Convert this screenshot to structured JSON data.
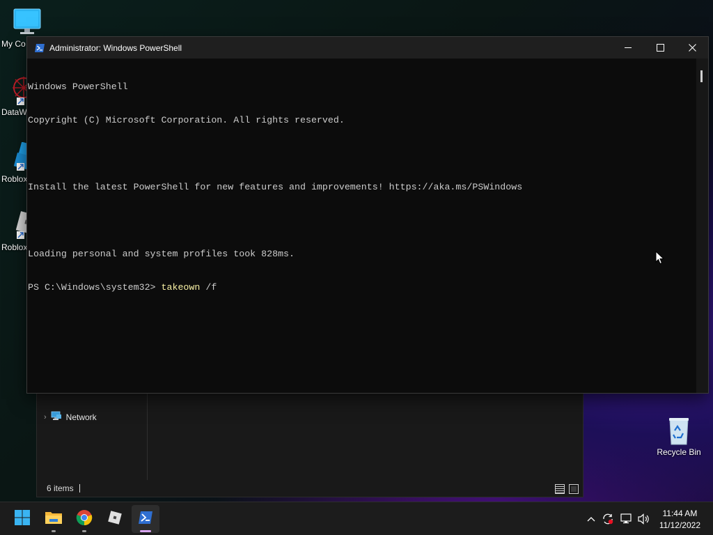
{
  "desktop": {
    "icons": [
      {
        "label": "My Co",
        "icon": "computer-icon"
      },
      {
        "label": "DataW",
        "icon": "datawrapper-icon"
      },
      {
        "label": "Roblox",
        "icon": "roblox-studio-icon"
      },
      {
        "label": "Roblox",
        "icon": "roblox-player-icon"
      },
      {
        "label": "Recycle Bin",
        "icon": "recycle-bin-icon"
      }
    ]
  },
  "explorer": {
    "nav_item": "Network",
    "status_count": "6 items"
  },
  "powershell": {
    "title": "Administrator: Windows PowerShell",
    "lines": [
      "Windows PowerShell",
      "Copyright (C) Microsoft Corporation. All rights reserved.",
      "",
      "Install the latest PowerShell for new features and improvements! https://aka.ms/PSWindows",
      "",
      "Loading personal and system profiles took 828ms."
    ],
    "prompt": "PS C:\\Windows\\system32> ",
    "command": "takeown",
    "argument": " /f"
  },
  "taskbar": {
    "apps": [
      {
        "name": "Start",
        "icon": "windows-start-icon"
      },
      {
        "name": "File Explorer",
        "icon": "folder-icon"
      },
      {
        "name": "Google Chrome",
        "icon": "chrome-icon"
      },
      {
        "name": "Roblox",
        "icon": "roblox-icon"
      },
      {
        "name": "Windows PowerShell",
        "icon": "powershell-icon"
      }
    ],
    "time": "11:44 AM",
    "date": "11/12/2022"
  }
}
